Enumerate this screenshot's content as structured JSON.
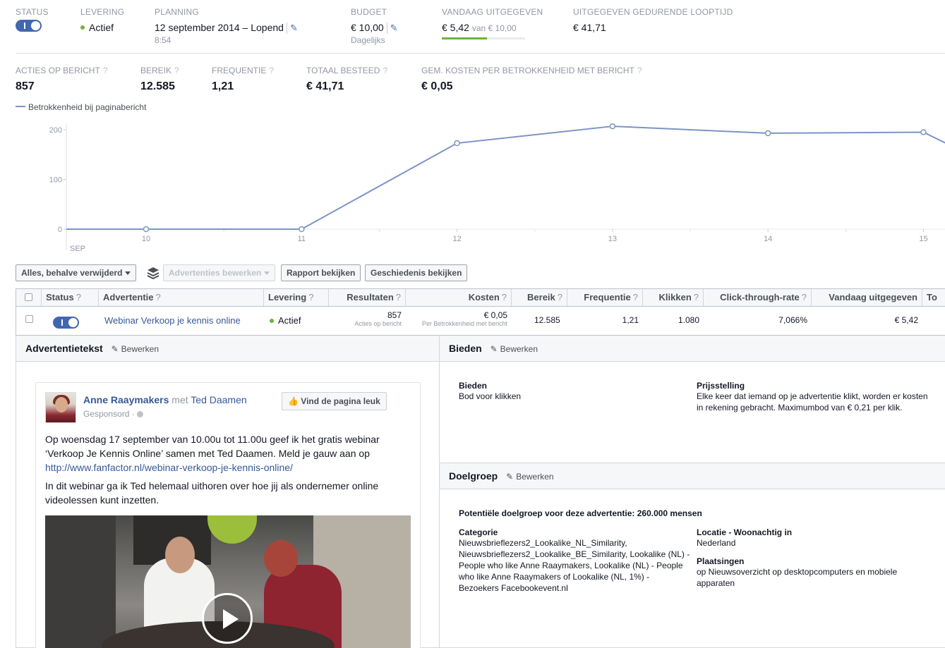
{
  "top": {
    "status": {
      "label": "STATUS"
    },
    "levering": {
      "label": "LEVERING",
      "value": "Actief"
    },
    "planning": {
      "label": "PLANNING",
      "value": "12 september 2014  –  Lopend",
      "time": "8:54"
    },
    "budget": {
      "label": "BUDGET",
      "value": "€ 10,00",
      "sub": "Dagelijks"
    },
    "vandaag": {
      "label": "VANDAAG UITGEGEVEN",
      "value": "€ 5,42",
      "of": "van € 10,00",
      "progress": 0.542
    },
    "looptijd": {
      "label": "UITGEGEVEN GEDURENDE LOOPTIJD",
      "value": "€ 41,71"
    }
  },
  "metrics": [
    {
      "label": "ACTIES OP BERICHT",
      "value": "857"
    },
    {
      "label": "BEREIK",
      "value": "12.585"
    },
    {
      "label": "FREQUENTIE",
      "value": "1,21"
    },
    {
      "label": "TOTAAL BESTEED",
      "value": "€ 41,71"
    },
    {
      "label": "GEM. KOSTEN PER BETROKKENHEID MET BERICHT",
      "value": "€ 0,05"
    }
  ],
  "question_mark": "?",
  "chart_data": {
    "type": "line",
    "series": [
      {
        "name": "Betrokkenheid bij paginabericht",
        "values": [
          0,
          0,
          0,
          173,
          207,
          193,
          195,
          172
        ]
      }
    ],
    "x": [
      9.6,
      10,
      11,
      12,
      13,
      14,
      15,
      15.15
    ],
    "x_tick_labels": [
      "10",
      "11",
      "12",
      "13",
      "14",
      "15"
    ],
    "x_month_label": "SEP",
    "y_tick_labels": [
      "0",
      "100",
      "200"
    ],
    "ylim": [
      0,
      200
    ],
    "line_color": "#7c94c5",
    "legend": "top-left"
  },
  "toolbar": {
    "filter": "Alles, behalve verwijderd",
    "edit_ads": "Advertenties bewerken",
    "report": "Rapport bekijken",
    "history": "Geschiedenis bekijken"
  },
  "table": {
    "headers": {
      "status": "Status",
      "advertentie": "Advertentie",
      "levering": "Levering",
      "resultaten": "Resultaten",
      "kosten": "Kosten",
      "bereik": "Bereik",
      "frequentie": "Frequentie",
      "klikken": "Klikken",
      "ctr": "Click-through-rate",
      "vandaag": "Vandaag uitgegeven",
      "extra": "To"
    },
    "row": {
      "advertentie": "Webinar Verkoop je kennis online",
      "levering": "Actief",
      "resultaten": "857",
      "resultaten_sub": "Acties op bericht",
      "kosten": "€ 0,05",
      "kosten_sub": "Per Betrokkenheid met bericht",
      "bereik": "12.585",
      "frequentie": "1,21",
      "klikken": "1.080",
      "ctr": "7,066%",
      "vandaag": "€ 5,42"
    }
  },
  "adtext_panel": {
    "title": "Advertentietekst",
    "edit": "Bewerken",
    "page_name": "Anne Raaymakers",
    "with_text": "met",
    "with_name": "Ted Daamen",
    "sponsored": "Gesponsord",
    "like_button": "Vind de pagina leuk",
    "paragraph1": "Op woensdag 17 september van 10.00u tot 11.00u geef ik het gratis webinar ‘Verkoop Je Kennis Online’ samen met Ted Daamen. Meld je gauw aan op ",
    "link": "http://www.fanfactor.nl/webinar-verkoop-je-kennis-online/",
    "paragraph2": "In dit webinar ga ik Ted helemaal uithoren over hoe jij als ondernemer online videolessen kunt inzetten."
  },
  "bieden_panel": {
    "title": "Bieden",
    "edit": "Bewerken",
    "bid_label": "Bieden",
    "bid_value": "Bod voor klikken",
    "price_label": "Prijsstelling",
    "price_value": "Elke keer dat iemand op je advertentie klikt, worden er kosten in rekening gebracht. Maximumbod van € 0,21 per klik."
  },
  "doelgroep_panel": {
    "title": "Doelgroep",
    "edit": "Bewerken",
    "potential": "Potentiële doelgroep voor deze advertentie: 260.000 mensen",
    "category_label": "Categorie",
    "category_value": "Nieuwsbrieflezers2_Lookalike_NL_Similarity, Nieuwsbrieflezers2_Lookalike_BE_Similarity, Lookalike (NL) - People who like Anne Raaymakers, Lookalike (NL) - People who like Anne Raaymakers of Lookalike (NL, 1%) - Bezoekers Facebookevent.nl",
    "location_label": "Locatie - Woonachtig in",
    "location_value": "Nederland",
    "placements_label": "Plaatsingen",
    "placements_value": "op Nieuwsoverzicht op desktopcomputers en mobiele apparaten"
  }
}
